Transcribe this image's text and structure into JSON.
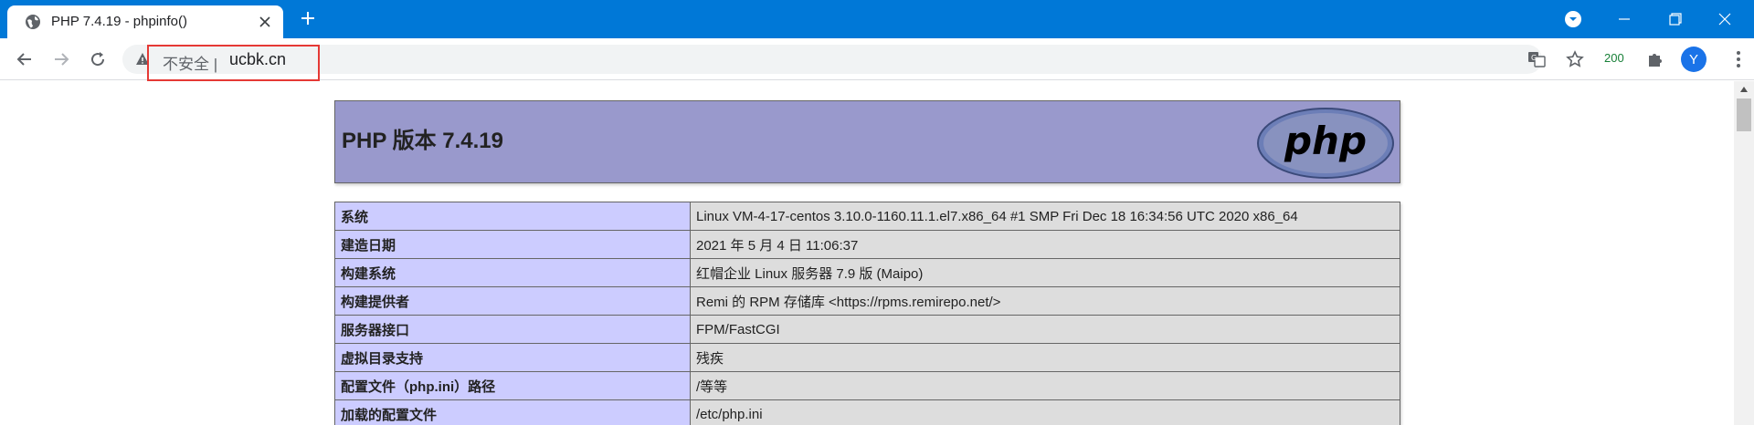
{
  "browser": {
    "tab_title": "PHP 7.4.19 - phpinfo()",
    "insecure_label": "不安全",
    "separator": "|",
    "url": "ucbk.cn",
    "extension_badge": "200",
    "avatar_letter": "Y",
    "accent_color": "#0078d7"
  },
  "page": {
    "php_title": "PHP 版本 7.4.19",
    "logo_text": "php",
    "rows": [
      {
        "label": "系统",
        "value": "Linux VM-4-17-centos 3.10.0-1160.11.1.el7.x86_64 #1 SMP Fri Dec 18 16:34:56 UTC 2020 x86_64"
      },
      {
        "label": "建造日期",
        "value": "2021 年 5 月 4 日 11:06:37"
      },
      {
        "label": "构建系统",
        "value": "红帽企业 Linux 服务器 7.9 版 (Maipo)"
      },
      {
        "label": "构建提供者",
        "value": "Remi 的 RPM 存储库 <https://rpms.remirepo.net/>"
      },
      {
        "label": "服务器接口",
        "value": "FPM/FastCGI"
      },
      {
        "label": "虚拟目录支持",
        "value": "残疾"
      },
      {
        "label": "配置文件（php.ini）路径",
        "value": "/等等"
      },
      {
        "label": "加载的配置文件",
        "value": "/etc/php.ini"
      }
    ]
  }
}
